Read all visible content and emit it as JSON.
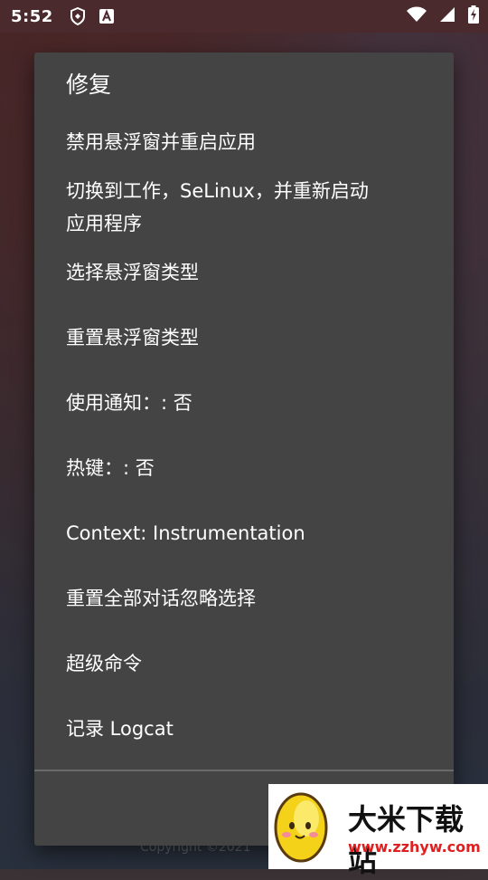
{
  "status_bar": {
    "time": "5:52",
    "icons_left": [
      "shield-badge-icon",
      "font-a-icon"
    ],
    "icons_right": [
      "wifi-icon",
      "signal-icon",
      "battery-charging-icon"
    ]
  },
  "background": {
    "copyright": "Copyright ©2021"
  },
  "dialog": {
    "title": "修复",
    "items": [
      {
        "label": "禁用悬浮窗并重启应用"
      },
      {
        "label": "切换到工作，SeLinux，并重新启动"
      },
      {
        "label": "应用程序"
      },
      {
        "label": "选择悬浮窗类型"
      },
      {
        "label": "重置悬浮窗类型"
      },
      {
        "label": "使用通知：: 否"
      },
      {
        "label": "热键：: 否"
      },
      {
        "label": "Context: Instrumentation"
      },
      {
        "label": "重置全部对话忽略选择"
      },
      {
        "label": "超级命令"
      },
      {
        "label": "记录 Logcat"
      }
    ]
  },
  "watermark": {
    "title": "大米下载站",
    "url": "www.zzhyw.com"
  },
  "colors": {
    "dialog_bg": "#444444",
    "text": "#ffffff",
    "watermark_url": "#e02020"
  }
}
